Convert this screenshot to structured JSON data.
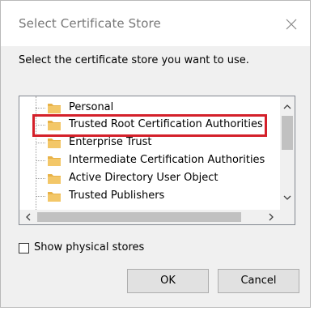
{
  "dialog": {
    "title": "Select Certificate Store",
    "instruction": "Select the certificate store you want to use."
  },
  "tree": {
    "items": [
      {
        "label": "Personal",
        "icon": "folder-icon"
      },
      {
        "label": "Trusted Root Certification Authorities",
        "icon": "folder-icon",
        "highlighted": true
      },
      {
        "label": "Enterprise Trust",
        "icon": "folder-icon"
      },
      {
        "label": "Intermediate Certification Authorities",
        "icon": "folder-icon"
      },
      {
        "label": "Active Directory User Object",
        "icon": "folder-icon"
      },
      {
        "label": "Trusted Publishers",
        "icon": "folder-icon"
      }
    ],
    "scroll_up_glyph": "^",
    "scroll_down_glyph": "v",
    "scroll_left_glyph": "<",
    "scroll_right_glyph": ">"
  },
  "options": {
    "show_physical_stores_label": "Show physical stores",
    "show_physical_stores_checked": false
  },
  "buttons": {
    "ok_label": "OK",
    "cancel_label": "Cancel"
  },
  "colors": {
    "highlight_border": "#d4202a",
    "folder_fill": "#f3c768",
    "folder_tab": "#e8b247"
  }
}
